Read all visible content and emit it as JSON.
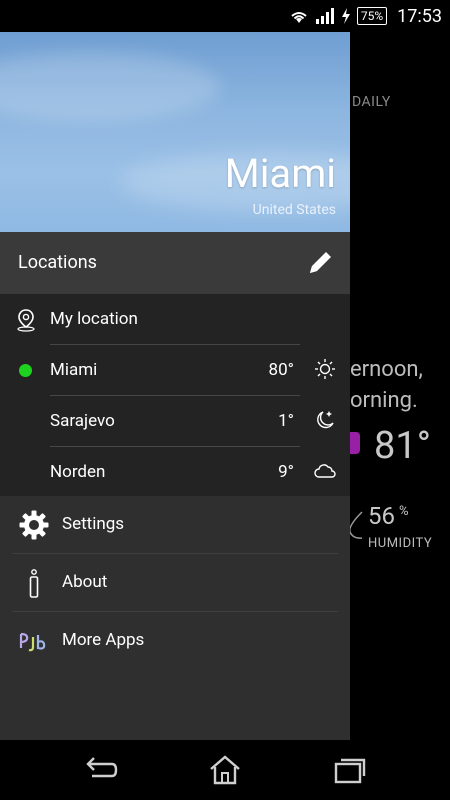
{
  "status_bar": {
    "battery": "75%",
    "time": "17:53"
  },
  "background": {
    "tab_daily": "DAILY",
    "summary_line1": "ernoon,",
    "summary_line2": "orning.",
    "temperature": "81°",
    "humidity_value": "56",
    "humidity_unit": "%",
    "humidity_label": "HUMIDITY"
  },
  "drawer": {
    "header": {
      "city": "Miami",
      "country": "United States"
    },
    "locations_title": "Locations",
    "locations": [
      {
        "name": "My location",
        "icon": "location-pin-icon"
      },
      {
        "name": "Miami",
        "temp": "80°",
        "icon": "sun-icon",
        "active": true
      },
      {
        "name": "Sarajevo",
        "temp": "1°",
        "icon": "moon-icon"
      },
      {
        "name": "Norden",
        "temp": "9°",
        "icon": "cloud-icon"
      }
    ],
    "menu": [
      {
        "label": "Settings",
        "icon": "gear-icon"
      },
      {
        "label": "About",
        "icon": "info-icon"
      },
      {
        "label": "More Apps",
        "icon": "more-apps-logo-icon"
      }
    ]
  },
  "nav_bar": {
    "buttons": [
      "back-icon",
      "home-icon",
      "recent-apps-icon"
    ]
  },
  "colors": {
    "active_dot": "#1fd21f",
    "accent_purple": "#9a1fa7",
    "drawer_bg": "#2f2f2f"
  }
}
